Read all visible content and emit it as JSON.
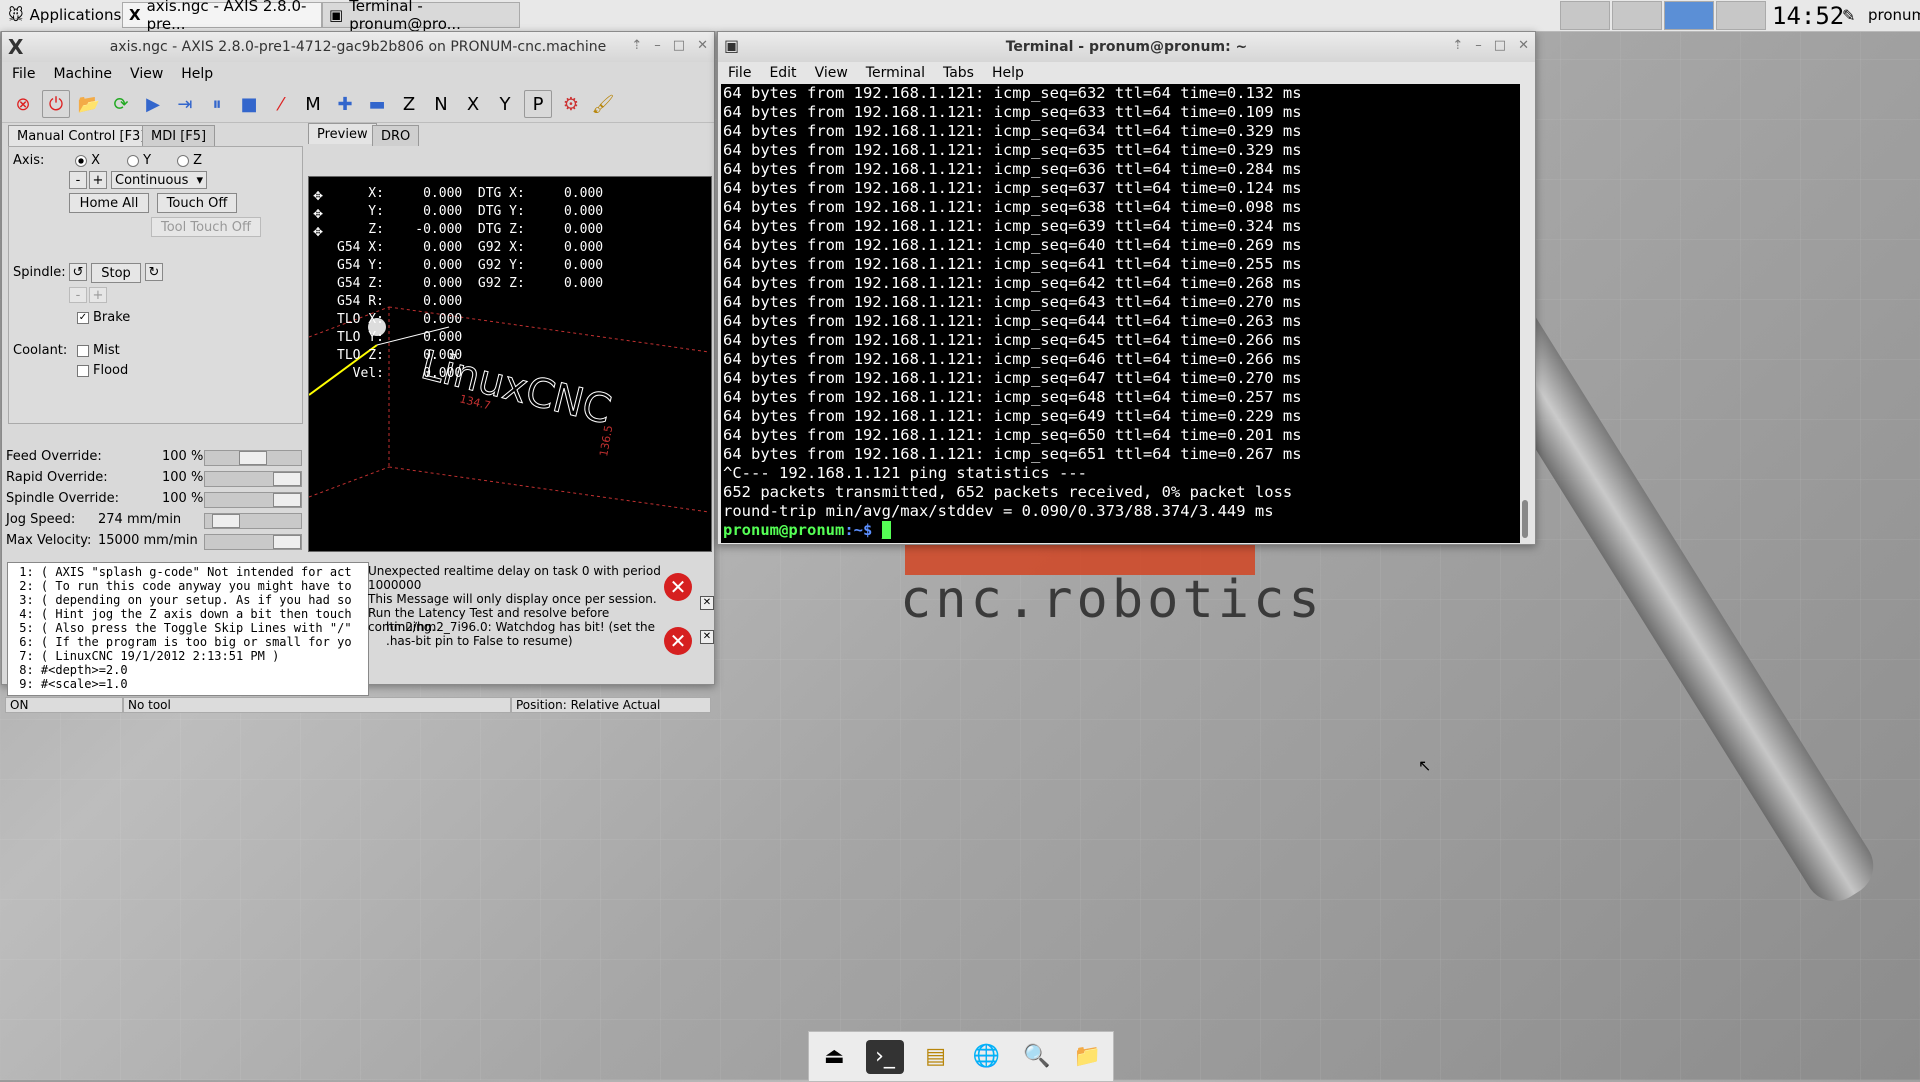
{
  "panel": {
    "applications_label": "Applications",
    "tasks": [
      {
        "label": "axis.ngc - AXIS 2.8.0-pre...",
        "active": true
      },
      {
        "label": "Terminal - pronum@pro...",
        "active": false
      }
    ],
    "clock": "14:52",
    "user": "pronum"
  },
  "axis": {
    "title": "axis.ngc - AXIS 2.8.0-pre1-4712-gac9b2b806 on PRONUM-cnc.machine",
    "menu": [
      "File",
      "Machine",
      "View",
      "Help"
    ],
    "tabs": {
      "manual": "Manual Control [F3]",
      "mdi": "MDI [F5]",
      "preview": "Preview",
      "dro": "DRO"
    },
    "axis_label": "Axis:",
    "axes": [
      "X",
      "Y",
      "Z"
    ],
    "selected_axis": "X",
    "jog_minus": "-",
    "jog_plus": "+",
    "jog_mode": "Continuous",
    "home_all": "Home All",
    "touch_off": "Touch Off",
    "tool_touch_off": "Tool Touch Off",
    "spindle_label": "Spindle:",
    "spindle_stop": "Stop",
    "brake_label": "Brake",
    "coolant_label": "Coolant:",
    "mist_label": "Mist",
    "flood_label": "Flood",
    "overrides": [
      {
        "label": "Feed Override:",
        "value": "100 %",
        "fraction": 0.5
      },
      {
        "label": "Rapid Override:",
        "value": "100 %",
        "fraction": 1.0
      },
      {
        "label": "Spindle Override:",
        "value": "100 %",
        "fraction": 1.0
      },
      {
        "label": "Jog Speed:",
        "value": "274 mm/min",
        "fraction": 0.1
      },
      {
        "label": "Max Velocity:",
        "value": "15000 mm/min",
        "fraction": 1.0
      }
    ],
    "dro_lines": [
      "    X:     0.000  DTG X:     0.000",
      "    Y:     0.000  DTG Y:     0.000",
      "    Z:    -0.000  DTG Z:     0.000",
      "G54 X:     0.000  G92 X:     0.000",
      "G54 Y:     0.000  G92 Y:     0.000",
      "G54 Z:     0.000  G92 Z:     0.000",
      "G54 R:     0.000",
      "TLO X:     0.000",
      "TLO Y:     0.000",
      "TLO Z:     0.000",
      "  Vel:     0.000"
    ],
    "preview_text": "LinuxCNC",
    "preview_dims": [
      "134.7",
      "136.5"
    ],
    "gcode": [
      " 1: ( AXIS \"splash g-code\" Not intended for act",
      " 2: ( To run this code anyway you might have to",
      " 3: ( depending on your setup. As if you had so",
      " 4: ( Hint jog the Z axis down a bit then touch",
      " 5: ( Also press the Toggle Skip Lines with \"/\"",
      " 6: ( If the program is too big or small for yo",
      " 7: ( LinuxCNC 19/1/2012 2:13:51 PM )",
      " 8: #<depth>=2.0",
      " 9: #<scale>=1.0"
    ],
    "messages": [
      "Unexpected realtime delay on task 0 with period 1000000\nThis Message will only display once per session.\nRun the Latency Test and resolve before continuing.",
      "hm2/hm2_7i96.0: Watchdog has bit! (set the .has-bit pin to False to resume)"
    ],
    "status": {
      "state": "ON",
      "tool": "No tool",
      "position": "Position: Relative Actual"
    }
  },
  "terminal": {
    "title": "Terminal - pronum@pronum: ~",
    "menu": [
      "File",
      "Edit",
      "View",
      "Terminal",
      "Tabs",
      "Help"
    ],
    "lines": [
      "64 bytes from 192.168.1.121: icmp_seq=632 ttl=64 time=0.132 ms",
      "64 bytes from 192.168.1.121: icmp_seq=633 ttl=64 time=0.109 ms",
      "64 bytes from 192.168.1.121: icmp_seq=634 ttl=64 time=0.329 ms",
      "64 bytes from 192.168.1.121: icmp_seq=635 ttl=64 time=0.329 ms",
      "64 bytes from 192.168.1.121: icmp_seq=636 ttl=64 time=0.284 ms",
      "64 bytes from 192.168.1.121: icmp_seq=637 ttl=64 time=0.124 ms",
      "64 bytes from 192.168.1.121: icmp_seq=638 ttl=64 time=0.098 ms",
      "64 bytes from 192.168.1.121: icmp_seq=639 ttl=64 time=0.324 ms",
      "64 bytes from 192.168.1.121: icmp_seq=640 ttl=64 time=0.269 ms",
      "64 bytes from 192.168.1.121: icmp_seq=641 ttl=64 time=0.255 ms",
      "64 bytes from 192.168.1.121: icmp_seq=642 ttl=64 time=0.268 ms",
      "64 bytes from 192.168.1.121: icmp_seq=643 ttl=64 time=0.270 ms",
      "64 bytes from 192.168.1.121: icmp_seq=644 ttl=64 time=0.263 ms",
      "64 bytes from 192.168.1.121: icmp_seq=645 ttl=64 time=0.266 ms",
      "64 bytes from 192.168.1.121: icmp_seq=646 ttl=64 time=0.266 ms",
      "64 bytes from 192.168.1.121: icmp_seq=647 ttl=64 time=0.270 ms",
      "64 bytes from 192.168.1.121: icmp_seq=648 ttl=64 time=0.257 ms",
      "64 bytes from 192.168.1.121: icmp_seq=649 ttl=64 time=0.229 ms",
      "64 bytes from 192.168.1.121: icmp_seq=650 ttl=64 time=0.201 ms",
      "64 bytes from 192.168.1.121: icmp_seq=651 ttl=64 time=0.267 ms",
      "^C--- 192.168.1.121 ping statistics ---",
      "652 packets transmitted, 652 packets received, 0% packet loss",
      "round-trip min/avg/max/stddev = 0.090/0.373/88.374/3.449 ms"
    ],
    "prompt_user": "pronum@pronum",
    "prompt_path": ":~$ "
  },
  "wallpaper": {
    "logo_text": "cnc.robotics"
  },
  "colors": {
    "prompt_green": "#55ff55",
    "prompt_blue": "#5c8fff",
    "error_red": "#d62020",
    "workspace_active": "#5b8fd6"
  }
}
